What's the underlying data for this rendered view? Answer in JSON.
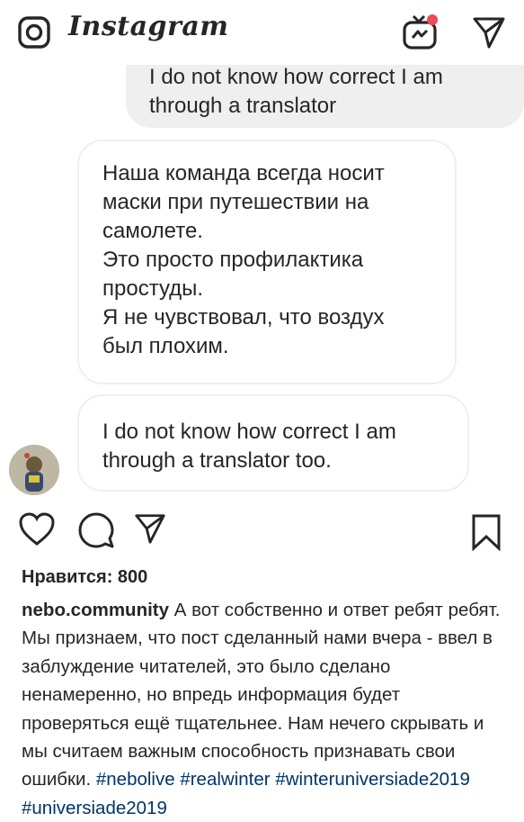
{
  "header": {
    "app_name": "Instagram",
    "icons": [
      "camera-icon",
      "igtv-icon",
      "direct-send-icon"
    ]
  },
  "chat": {
    "my_message_partial": "I do not know how correct I am",
    "my_message_line2": "through a translator",
    "their_message_1": [
      "Наша команда всегда носит",
      "маски при путешествии на",
      "самолете.",
      "Это просто профилактика",
      "простуды.",
      "Я не чувствовал, что воздух",
      "был плохим."
    ],
    "their_message_2": [
      "I do not know how correct I am",
      "through a translator too."
    ]
  },
  "post": {
    "likes_label": "Нравится: 800",
    "username": "nebo.community",
    "caption_text": "А вот собственно и ответ ребят ребят. Мы признаем, что пост сделанный нами вчера - ввел в заблуждение читателей, это было сделано ненамеренно, но впредь информация будет проверяться ещё тщательнее. Нам нечего скрывать и мы считаем важным способность признавать свои ошибки.",
    "hashtags": [
      "#nebolive",
      "#realwinter",
      "#winteruniversiade2019",
      "#universiade2019"
    ]
  },
  "colors": {
    "my_bubble": "#efefef",
    "their_bubble_border": "#efefef",
    "hashtag": "#003569",
    "notification_dot": "#ed4956",
    "text": "#262626"
  }
}
